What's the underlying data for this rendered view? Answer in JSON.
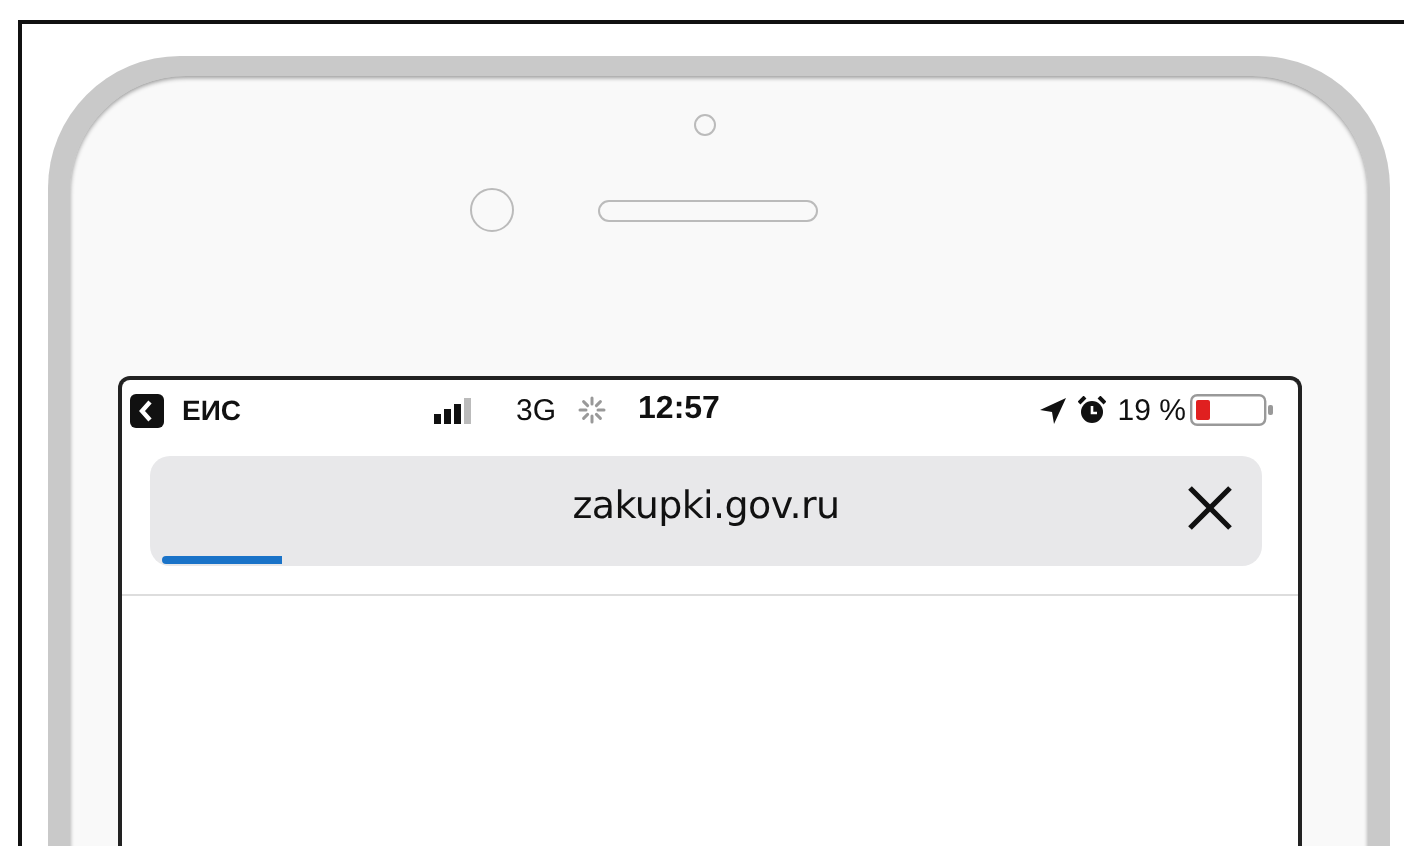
{
  "status_bar": {
    "back_app": "ЕИС",
    "network": "3G",
    "time": "12:57",
    "battery_percent": "19 %"
  },
  "address_bar": {
    "url": "zakupki.gov.ru",
    "progress": {
      "level": 0.11
    }
  }
}
